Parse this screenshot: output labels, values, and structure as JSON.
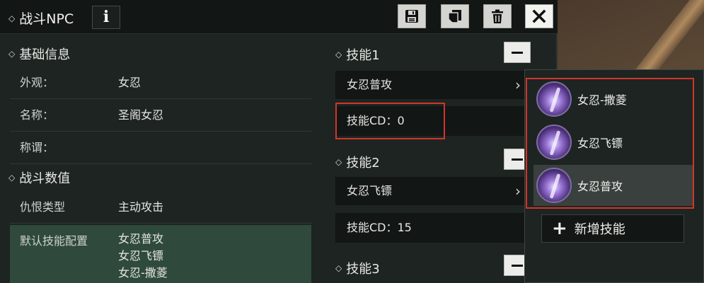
{
  "titlebar": {
    "title": "战斗NPC",
    "info_label": "i"
  },
  "basic_info": {
    "header": "基础信息",
    "rows": [
      {
        "key": "外观：",
        "value": "女忍"
      },
      {
        "key": "名称：",
        "value": "圣阁女忍"
      },
      {
        "key": "称谓：",
        "value": ""
      }
    ]
  },
  "combat_stats": {
    "header": "战斗数值",
    "hate_type_key": "仇恨类型",
    "hate_type_value": "主动攻击",
    "default_skills_key": "默认技能配置",
    "default_skills": [
      "女忍普攻",
      "女忍飞镖",
      "女忍-撒菱"
    ]
  },
  "skills": [
    {
      "header": "技能1",
      "name": "女忍普攻",
      "cd_label": "技能CD：",
      "cd_value": "0"
    },
    {
      "header": "技能2",
      "name": "女忍飞镖",
      "cd_label": "技能CD：",
      "cd_value": "15"
    },
    {
      "header": "技能3"
    }
  ],
  "skill_popup": {
    "options": [
      {
        "label": "女忍-撒菱",
        "selected": false
      },
      {
        "label": "女忍飞镖",
        "selected": false
      },
      {
        "label": "女忍普攻",
        "selected": true
      }
    ],
    "add_label": "新增技能"
  },
  "icons": {
    "save": "floppy-disk-icon",
    "copy": "copy-icon",
    "delete": "trash-icon",
    "close": "close-icon",
    "chevron": "chevron-right-icon"
  },
  "colors": {
    "highlight_border": "#d2352a",
    "config_bg": "#2f4a3c",
    "panel_bg": "#1d2422"
  }
}
